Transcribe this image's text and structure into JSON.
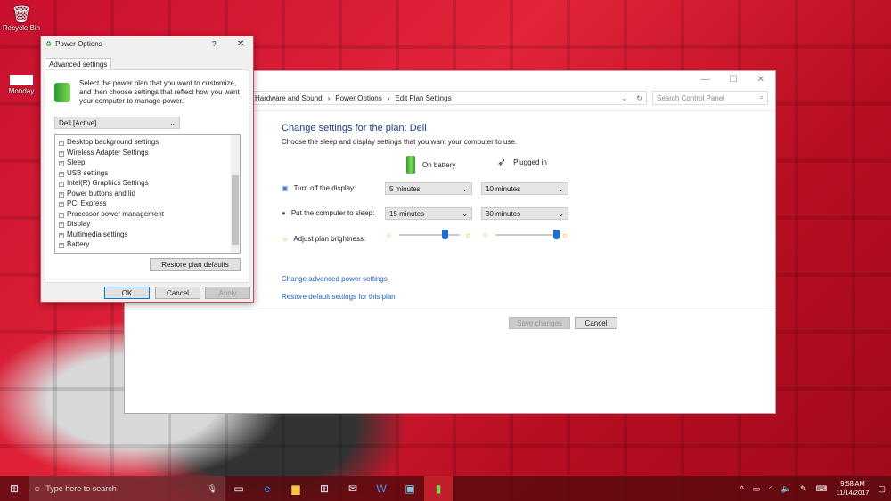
{
  "desktop": {
    "icons": [
      {
        "label": "Recycle Bin"
      },
      {
        "label": "Monday"
      }
    ]
  },
  "main": {
    "window_controls": {
      "minimize": "—",
      "maximize": "☐",
      "close": "✕"
    },
    "breadcrumb": [
      "Hardware and Sound",
      "Power Options",
      "Edit Plan Settings"
    ],
    "search_placeholder": "Search Control Panel",
    "title": "Change settings for the plan: Dell",
    "subtitle": "Choose the sleep and display settings that you want your computer to use.",
    "col_battery": "On battery",
    "col_plugged": "Plugged in",
    "rows": [
      {
        "label": "Turn off the display:",
        "battery": "5 minutes",
        "plugged": "10 minutes"
      },
      {
        "label": "Put the computer to sleep:",
        "battery": "15 minutes",
        "plugged": "30 minutes"
      }
    ],
    "brightness": {
      "label": "Adjust plan brightness:",
      "battery_percent": 75,
      "plugged_percent": 100
    },
    "links": [
      "Change advanced power settings",
      "Restore default settings for this plan"
    ],
    "save": "Save changes",
    "cancel": "Cancel"
  },
  "dialog": {
    "title": "Power Options",
    "help": "?",
    "close": "✕",
    "tab": "Advanced settings",
    "intro": "Select the power plan that you want to customize, and then choose settings that reflect how you want your computer to manage power.",
    "plan": "Dell [Active]",
    "settings": [
      "Desktop background settings",
      "Wireless Adapter Settings",
      "Sleep",
      "USB settings",
      "Intel(R) Graphics Settings",
      "Power buttons and lid",
      "PCI Express",
      "Processor power management",
      "Display",
      "Multimedia settings",
      "Battery"
    ],
    "restore": "Restore plan defaults",
    "ok": "OK",
    "cancel": "Cancel",
    "apply": "Apply"
  },
  "taskbar": {
    "search_placeholder": "Type here to search",
    "time": "9:58 AM",
    "date": "11/14/2017"
  }
}
